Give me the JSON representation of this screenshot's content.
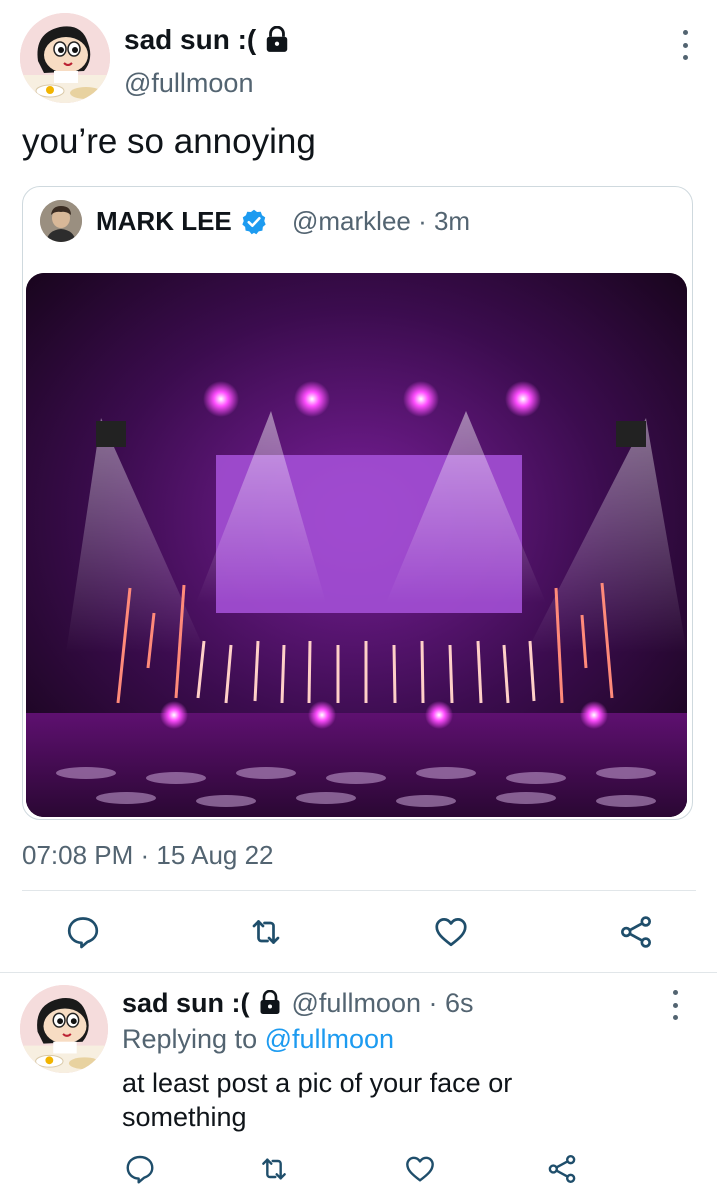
{
  "main_tweet": {
    "display_name": "sad sun :(",
    "handle": "@fullmoon",
    "text": "you’re so annoying",
    "timestamp": "07:08 PM · 15 Aug 22",
    "icons": {
      "protected": "lock-icon",
      "more": "more-vertical-icon",
      "reply": "reply-icon",
      "retweet": "retweet-icon",
      "like": "heart-icon",
      "share": "share-icon"
    }
  },
  "quoted_tweet": {
    "display_name": "MARK LEE",
    "meta": "@marklee · 3m",
    "verified_icon": "verified-badge-icon",
    "image": "concert-stage-photo"
  },
  "reply_tweet": {
    "display_name": "sad sun :(",
    "meta": "@fullmoon · 6s",
    "replying_prefix": "Replying to",
    "replying_handle": "@fullmoon",
    "text": "at least post a pic of your face or something"
  },
  "colors": {
    "link": "#1d9bf0",
    "secondary_text": "#536471",
    "primary_text": "#0f1419",
    "divider": "#e1e6e9"
  }
}
